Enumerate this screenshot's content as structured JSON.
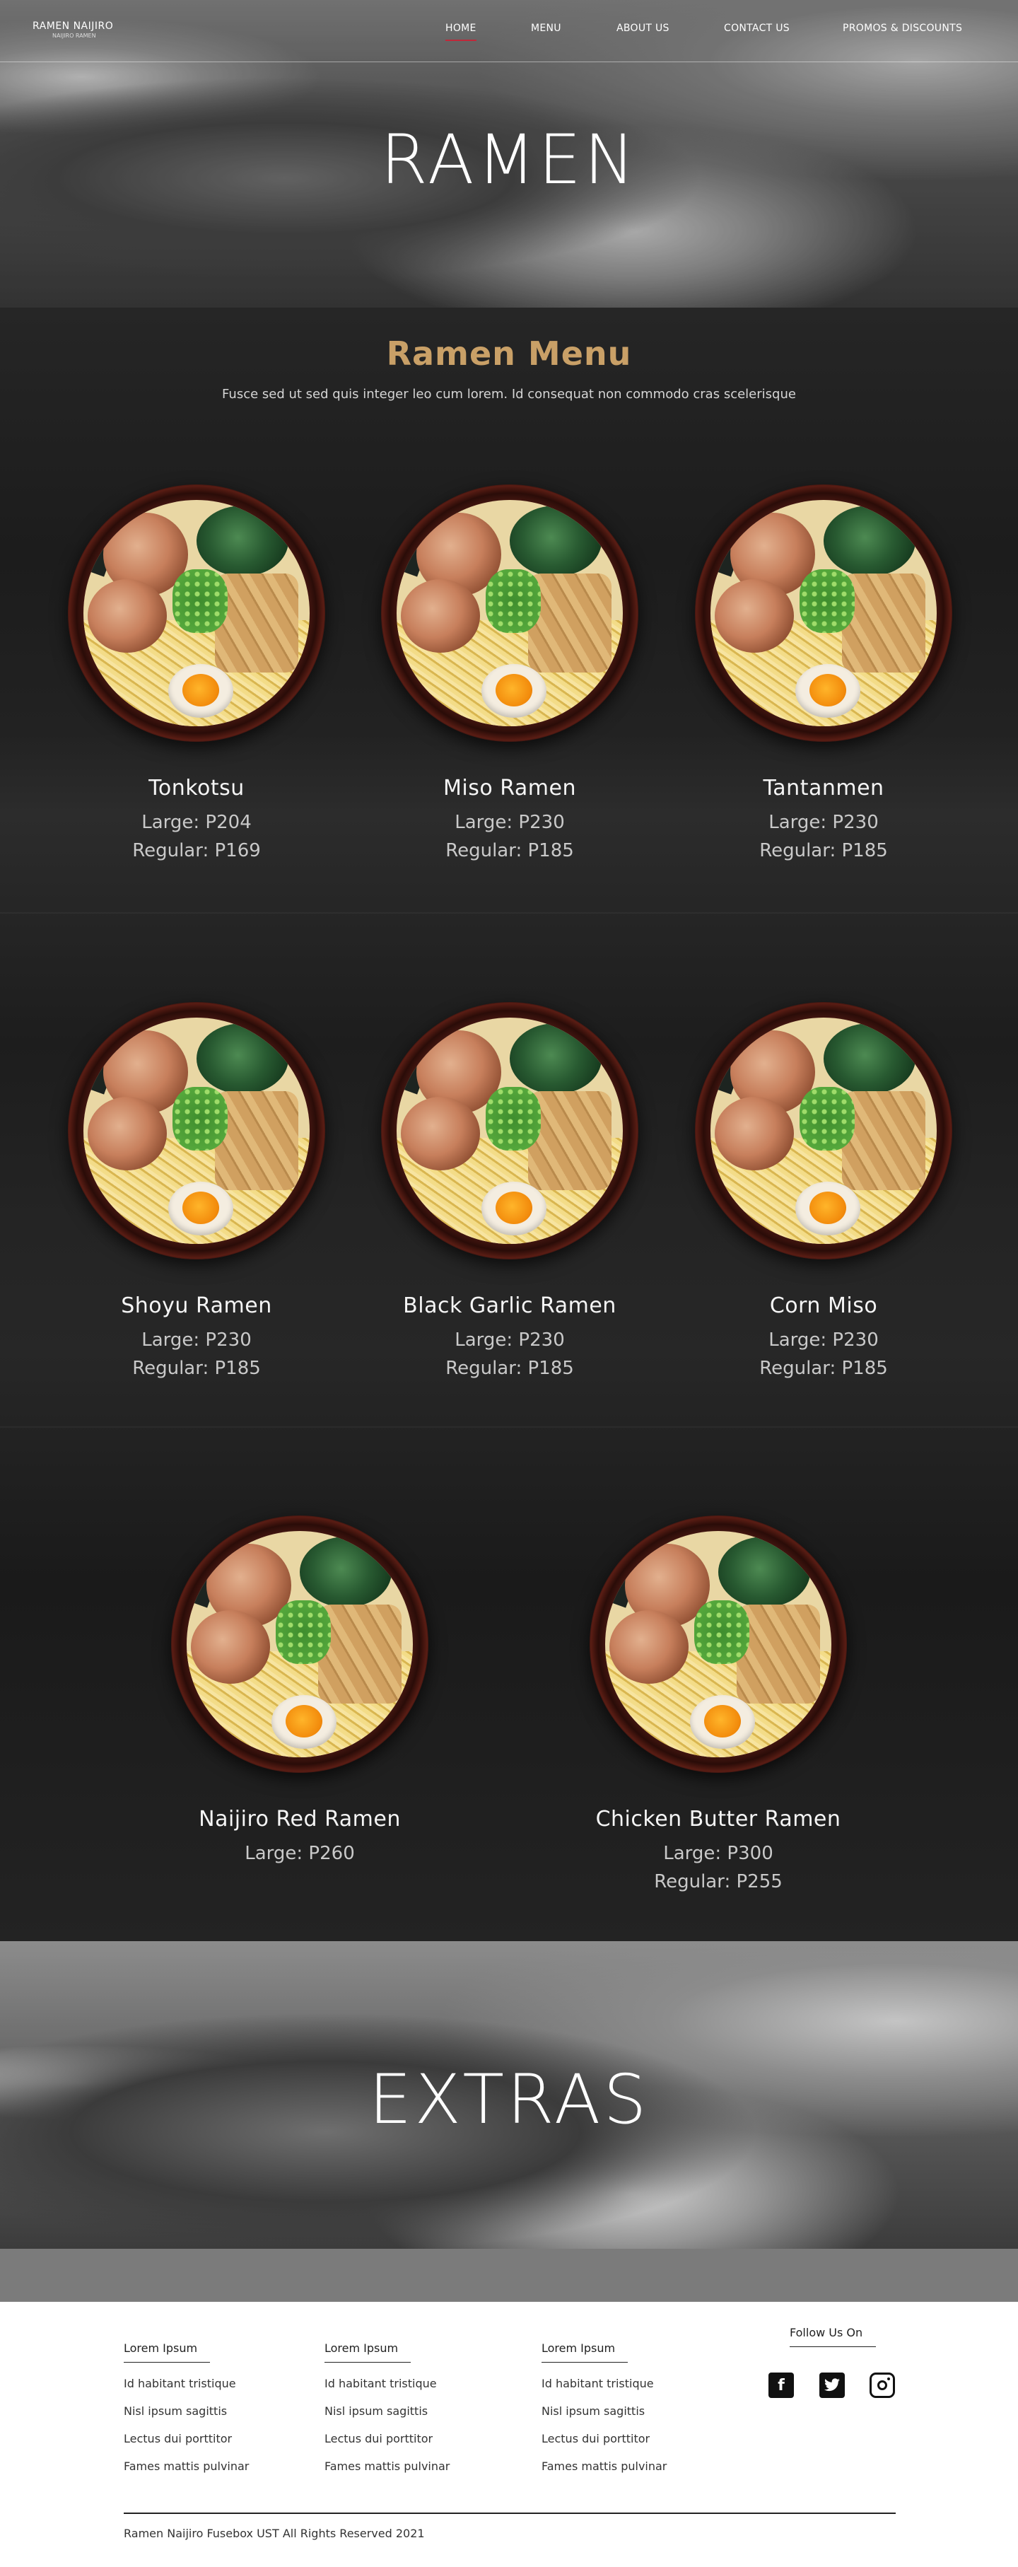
{
  "brand": {
    "name": "RAMEN NAIJIRO",
    "tagline": "NAIJIRO RAMEN"
  },
  "nav": {
    "home": "HOME",
    "menu": "MENU",
    "about": "ABOUT US",
    "contact": "CONTACT US",
    "promos": "PROMOS & DISCOUNTS"
  },
  "hero": {
    "title": "RAMEN"
  },
  "menu": {
    "title": "Ramen Menu",
    "subtitle": "Fusce sed ut sed quis integer leo cum lorem. Id consequat non commodo cras scelerisque",
    "items": [
      {
        "name": "Tonkotsu",
        "large": "Large: P204",
        "regular": "Regular: P169"
      },
      {
        "name": "Miso Ramen",
        "large": "Large: P230",
        "regular": "Regular: P185"
      },
      {
        "name": "Tantanmen",
        "large": "Large: P230",
        "regular": "Regular: P185"
      },
      {
        "name": "Shoyu Ramen",
        "large": "Large: P230",
        "regular": "Regular: P185"
      },
      {
        "name": "Black Garlic Ramen",
        "large": "Large: P230",
        "regular": "Regular: P185"
      },
      {
        "name": "Corn Miso",
        "large": "Large: P230",
        "regular": "Regular: P185"
      },
      {
        "name": "Naijiro Red Ramen",
        "large": "Large: P260"
      },
      {
        "name": "Chicken Butter Ramen",
        "large": "Large: P300",
        "regular": "Regular: P255"
      }
    ]
  },
  "extras": {
    "title": "EXTRAS"
  },
  "footer": {
    "columns": [
      {
        "heading": "Lorem Ipsum",
        "links": [
          "Id habitant tristique",
          "Nisl ipsum sagittis",
          "Lectus dui porttitor",
          "Fames mattis pulvinar"
        ]
      },
      {
        "heading": "Lorem Ipsum",
        "links": [
          "Id habitant tristique",
          "Nisl ipsum sagittis",
          "Lectus dui porttitor",
          "Fames mattis pulvinar"
        ]
      },
      {
        "heading": "Lorem Ipsum",
        "links": [
          "Id habitant tristique",
          "Nisl ipsum sagittis",
          "Lectus dui porttitor",
          "Fames mattis pulvinar"
        ]
      }
    ],
    "follow": "Follow Us On",
    "social_icons": [
      "facebook-icon",
      "twitter-icon",
      "instagram-icon"
    ],
    "copyright": "Ramen Naijiro Fusebox UST All Rights Reserved 2021"
  },
  "colors": {
    "accent": "#c9a067",
    "nav_active": "#c0283a",
    "footer_bg": "#ffffff",
    "gray_bar": "#7b7b7b"
  }
}
